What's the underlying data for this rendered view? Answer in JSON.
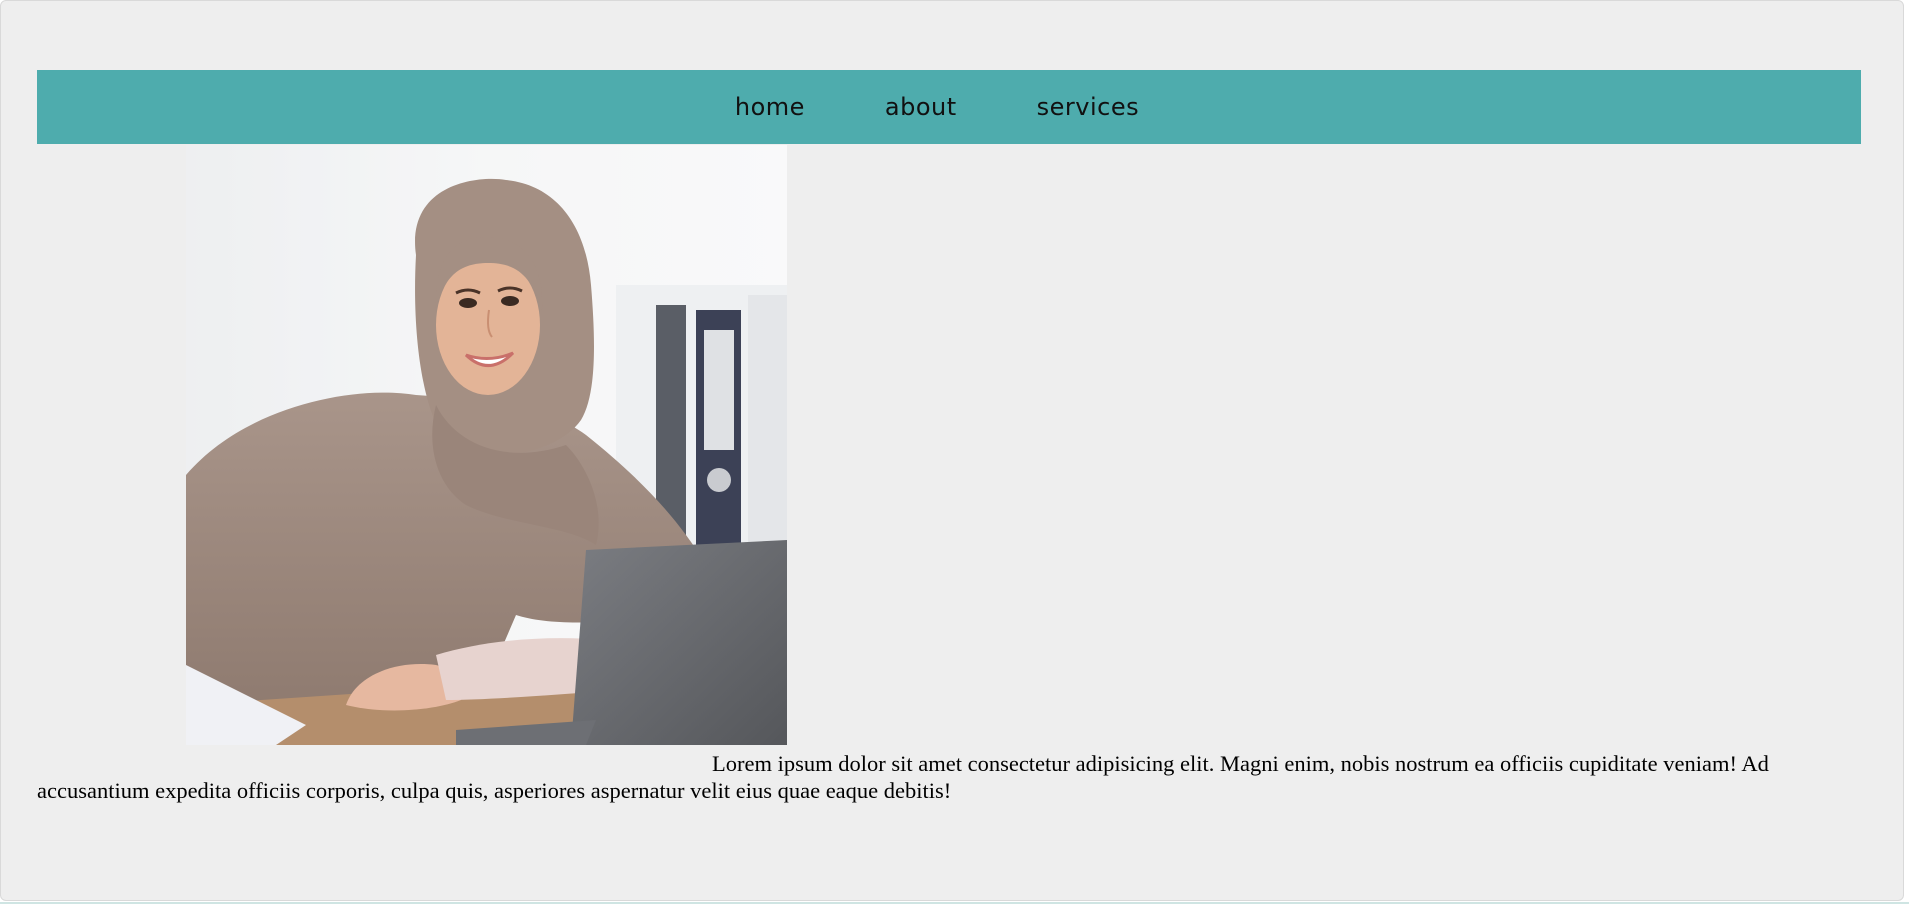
{
  "nav": {
    "items": [
      {
        "label": "home"
      },
      {
        "label": "about"
      },
      {
        "label": "services"
      }
    ]
  },
  "hero": {
    "image_icon": "woman-at-desk-photo"
  },
  "content": {
    "paragraph": "Lorem ipsum dolor sit amet consectetur adipisicing elit. Magni enim, nobis nostrum ea officiis cupiditate veniam! Ad accusantium expedita officiis corporis, culpa quis, asperiores aspernatur velit eius quae eaque debitis!"
  },
  "colors": {
    "page_background": "#eeeeee",
    "nav_background": "#4eacad",
    "nav_text": "#111111",
    "body_text": "#000000"
  }
}
